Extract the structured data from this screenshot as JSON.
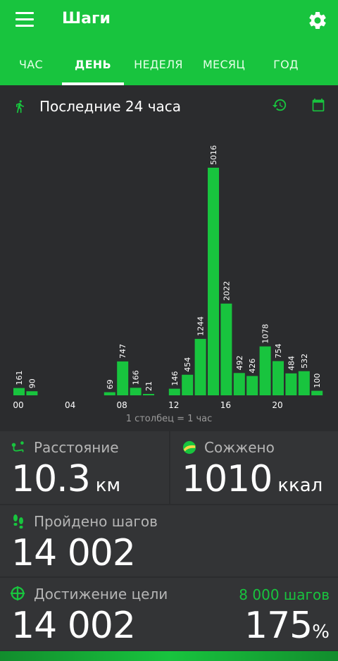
{
  "app": {
    "title": "Шаги"
  },
  "tabs": [
    {
      "label": "ЧАС"
    },
    {
      "label": "ДЕНЬ"
    },
    {
      "label": "НЕДЕЛЯ"
    },
    {
      "label": "МЕСЯЦ"
    },
    {
      "label": "ГОД"
    }
  ],
  "active_tab": "ДЕНЬ",
  "period": {
    "title": "Последние 24 часа"
  },
  "chart_data": {
    "type": "bar",
    "categories": [
      "00",
      "01",
      "02",
      "03",
      "04",
      "05",
      "06",
      "07",
      "08",
      "09",
      "10",
      "11",
      "12",
      "13",
      "14",
      "15",
      "16",
      "17",
      "18",
      "19",
      "20",
      "21",
      "22",
      "23"
    ],
    "values": [
      161,
      90,
      0,
      0,
      0,
      0,
      0,
      69,
      747,
      166,
      21,
      0,
      146,
      454,
      1244,
      5016,
      2022,
      492,
      426,
      1078,
      754,
      484,
      532,
      100
    ],
    "tick_labels": [
      "00",
      "04",
      "08",
      "12",
      "16",
      "20"
    ],
    "caption": "1 столбец = 1 час",
    "bar_color": "#18c43e"
  },
  "stats": {
    "distance": {
      "label": "Расстояние",
      "value": "10.3",
      "unit": "км"
    },
    "calories": {
      "label": "Сожжено",
      "value": "1010",
      "unit": "ккал"
    },
    "steps": {
      "label": "Пройдено шагов",
      "value": "14 002"
    },
    "goal": {
      "label": "Достижение цели",
      "target": "8 000 шагов",
      "value": "14 002",
      "percent": "175",
      "percent_sign": "%"
    }
  },
  "colors": {
    "accent": "#18c43e",
    "background": "#2b2c2e",
    "card": "#333436"
  }
}
